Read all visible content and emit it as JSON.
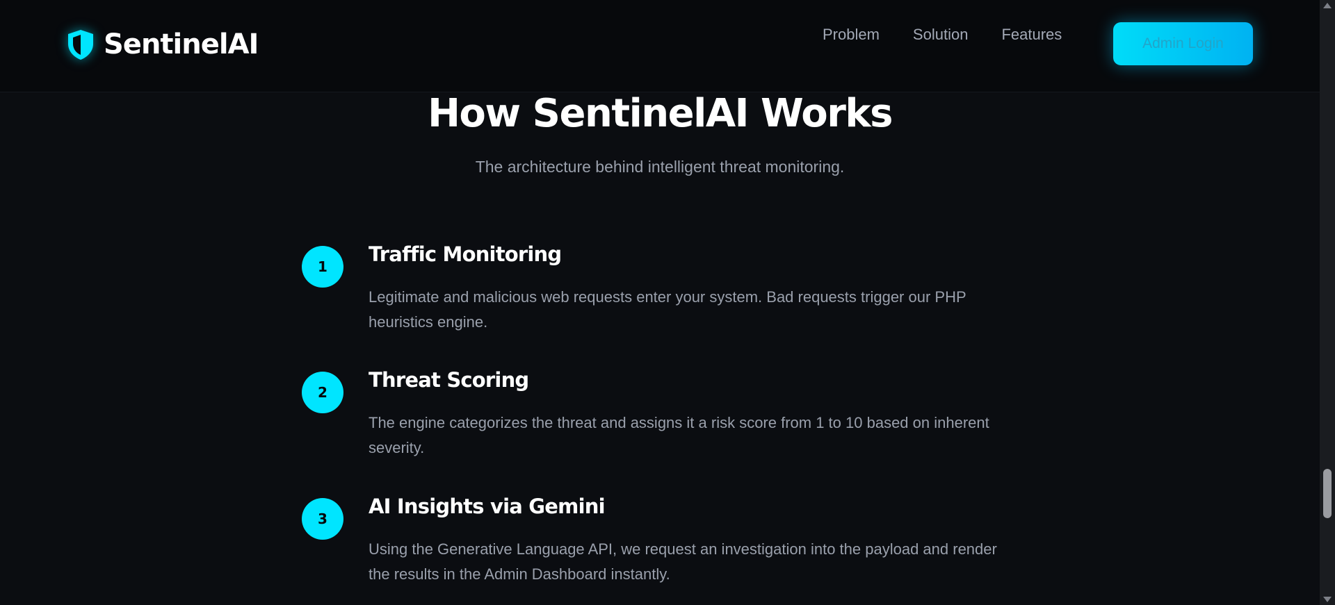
{
  "header": {
    "brand_name": "SentinelAI",
    "brand_icon": "shield-icon",
    "nav": [
      {
        "label": "Problem"
      },
      {
        "label": "Solution"
      },
      {
        "label": "Features"
      }
    ],
    "admin_login_label": "Admin Login"
  },
  "section": {
    "title": "How SentinelAI Works",
    "subtitle": "The architecture behind intelligent threat monitoring."
  },
  "steps": [
    {
      "number": "1",
      "title": "Traffic Monitoring",
      "description": "Legitimate and malicious web requests enter your system. Bad requests trigger our PHP heuristics engine."
    },
    {
      "number": "2",
      "title": "Threat Scoring",
      "description": "The engine categorizes the threat and assigns it a risk score from 1 to 10 based on inherent severity."
    },
    {
      "number": "3",
      "title": "AI Insights via Gemini",
      "description": "Using the Generative Language API, we request an investigation into the payload and render the results in the Admin Dashboard instantly."
    }
  ],
  "colors": {
    "accent": "#00e5ff",
    "background": "#0b0d11",
    "header_background": "#07090c",
    "muted_text": "#9aa0ac"
  }
}
